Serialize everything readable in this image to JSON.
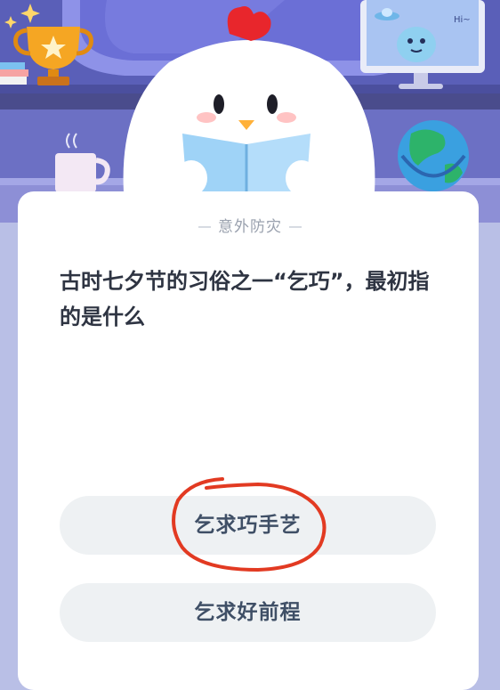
{
  "quiz": {
    "category": "意外防灾",
    "question": "古时七夕节的习俗之一“乞巧”，最初指的是什么",
    "options": [
      {
        "label": "乞求巧手艺"
      },
      {
        "label": "乞求好前程"
      }
    ]
  },
  "scene": {
    "monitor_text": "Hi~",
    "icons": [
      "trophy-icon",
      "mug-icon",
      "globe-icon",
      "monitor-icon",
      "mascot-chicken",
      "books-icon"
    ]
  },
  "colors": {
    "header_bg": "#6e72c9",
    "card_bg": "#ffffff",
    "option_bg": "#eef1f3",
    "annotation_red": "#e23a22"
  }
}
